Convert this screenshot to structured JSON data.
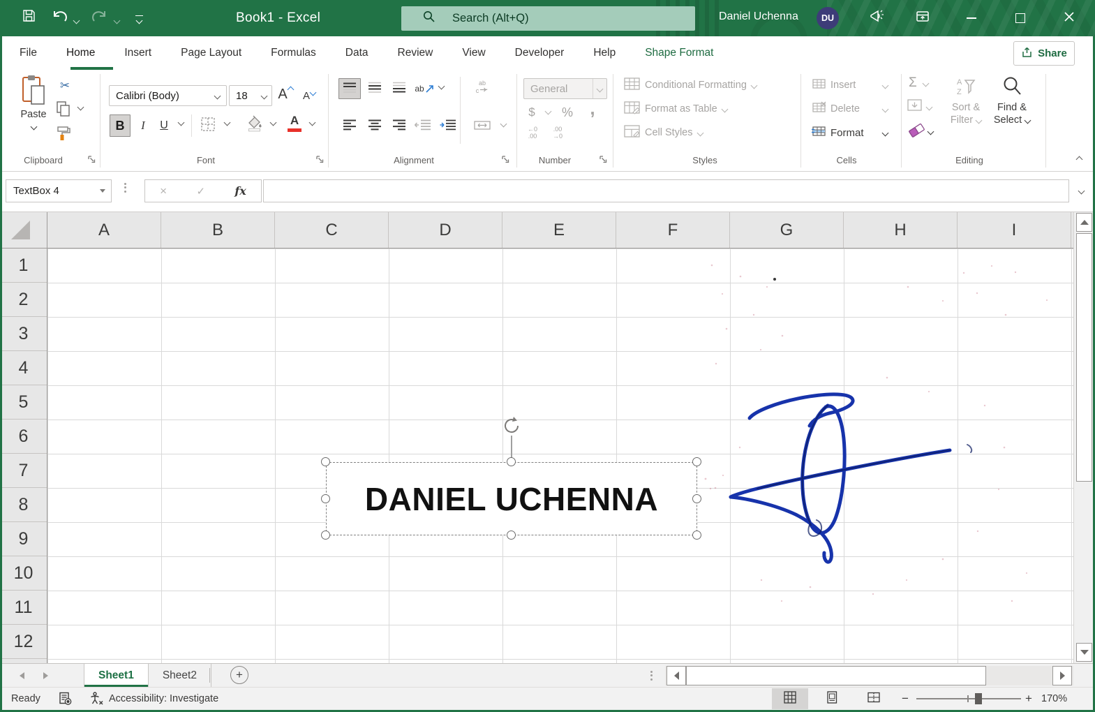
{
  "titlebar": {
    "title": "Book1 - Excel",
    "search_placeholder": "Search (Alt+Q)",
    "user_name": "Daniel Uchenna",
    "user_initials": "DU"
  },
  "ribbon_tabs": [
    {
      "label": "File",
      "state": "normal"
    },
    {
      "label": "Home",
      "state": "active"
    },
    {
      "label": "Insert",
      "state": "normal"
    },
    {
      "label": "Page Layout",
      "state": "normal"
    },
    {
      "label": "Formulas",
      "state": "normal"
    },
    {
      "label": "Data",
      "state": "normal"
    },
    {
      "label": "Review",
      "state": "normal"
    },
    {
      "label": "View",
      "state": "normal"
    },
    {
      "label": "Developer",
      "state": "normal"
    },
    {
      "label": "Help",
      "state": "normal"
    },
    {
      "label": "Shape Format",
      "state": "contextual"
    }
  ],
  "share_button": {
    "label": "Share"
  },
  "ribbon": {
    "clipboard": {
      "group_label": "Clipboard",
      "paste_label": "Paste"
    },
    "font": {
      "group_label": "Font",
      "font_name": "Calibri (Body)",
      "font_size": "18",
      "bold_glyph": "B",
      "italic_glyph": "I",
      "underline_glyph": "U",
      "grow_glyph": "A",
      "shrink_glyph": "A",
      "color_glyph": "A"
    },
    "alignment": {
      "group_label": "Alignment",
      "orientation_glyph": "ab",
      "wrap_line1": "ab",
      "wrap_line2": "c"
    },
    "number": {
      "group_label": "Number",
      "format_value": "General",
      "currency_glyph": "$",
      "percent_glyph": "%",
      "comma_glyph": ",",
      "inc_dec_top": "←0",
      "inc_dec_bottom": ".00",
      "dec_dec_top": ".00",
      "dec_dec_bottom": "→0"
    },
    "styles": {
      "group_label": "Styles",
      "items": [
        "Conditional Formatting",
        "Format as Table",
        "Cell Styles"
      ]
    },
    "cells": {
      "group_label": "Cells",
      "items": [
        "Insert",
        "Delete",
        "Format"
      ]
    },
    "editing": {
      "group_label": "Editing",
      "autosum_glyph": "Σ",
      "sort_line1": "Sort &",
      "sort_line2": "Filter",
      "find_line1": "Find &",
      "find_line2": "Select"
    }
  },
  "formula_bar": {
    "name_box_value": "TextBox 4",
    "cancel_glyph": "×",
    "enter_glyph": "✓",
    "fx_label": "fx",
    "formula_value": ""
  },
  "grid": {
    "columns": [
      "A",
      "B",
      "C",
      "D",
      "E",
      "F",
      "G",
      "H",
      "I"
    ],
    "rows": [
      "1",
      "2",
      "3",
      "4",
      "5",
      "6",
      "7",
      "8",
      "9",
      "10",
      "11",
      "12"
    ]
  },
  "shape": {
    "text": "DANIEL UCHENNA"
  },
  "sheet_bar": {
    "tabs": [
      {
        "label": "Sheet1",
        "active": true
      },
      {
        "label": "Sheet2",
        "active": false
      }
    ],
    "add_glyph": "+"
  },
  "status_bar": {
    "mode": "Ready",
    "accessibility": "Accessibility: Investigate",
    "zoom_out_glyph": "−",
    "zoom_in_glyph": "+",
    "zoom_level": "170%"
  },
  "colors": {
    "excel_green": "#217346",
    "search_box": "#A4CCBA",
    "avatar_bg": "#3D3C78",
    "font_color_bar": "#E8312A",
    "signature_ink": "#1733AB",
    "contextual_tab": "#1E6B41"
  }
}
